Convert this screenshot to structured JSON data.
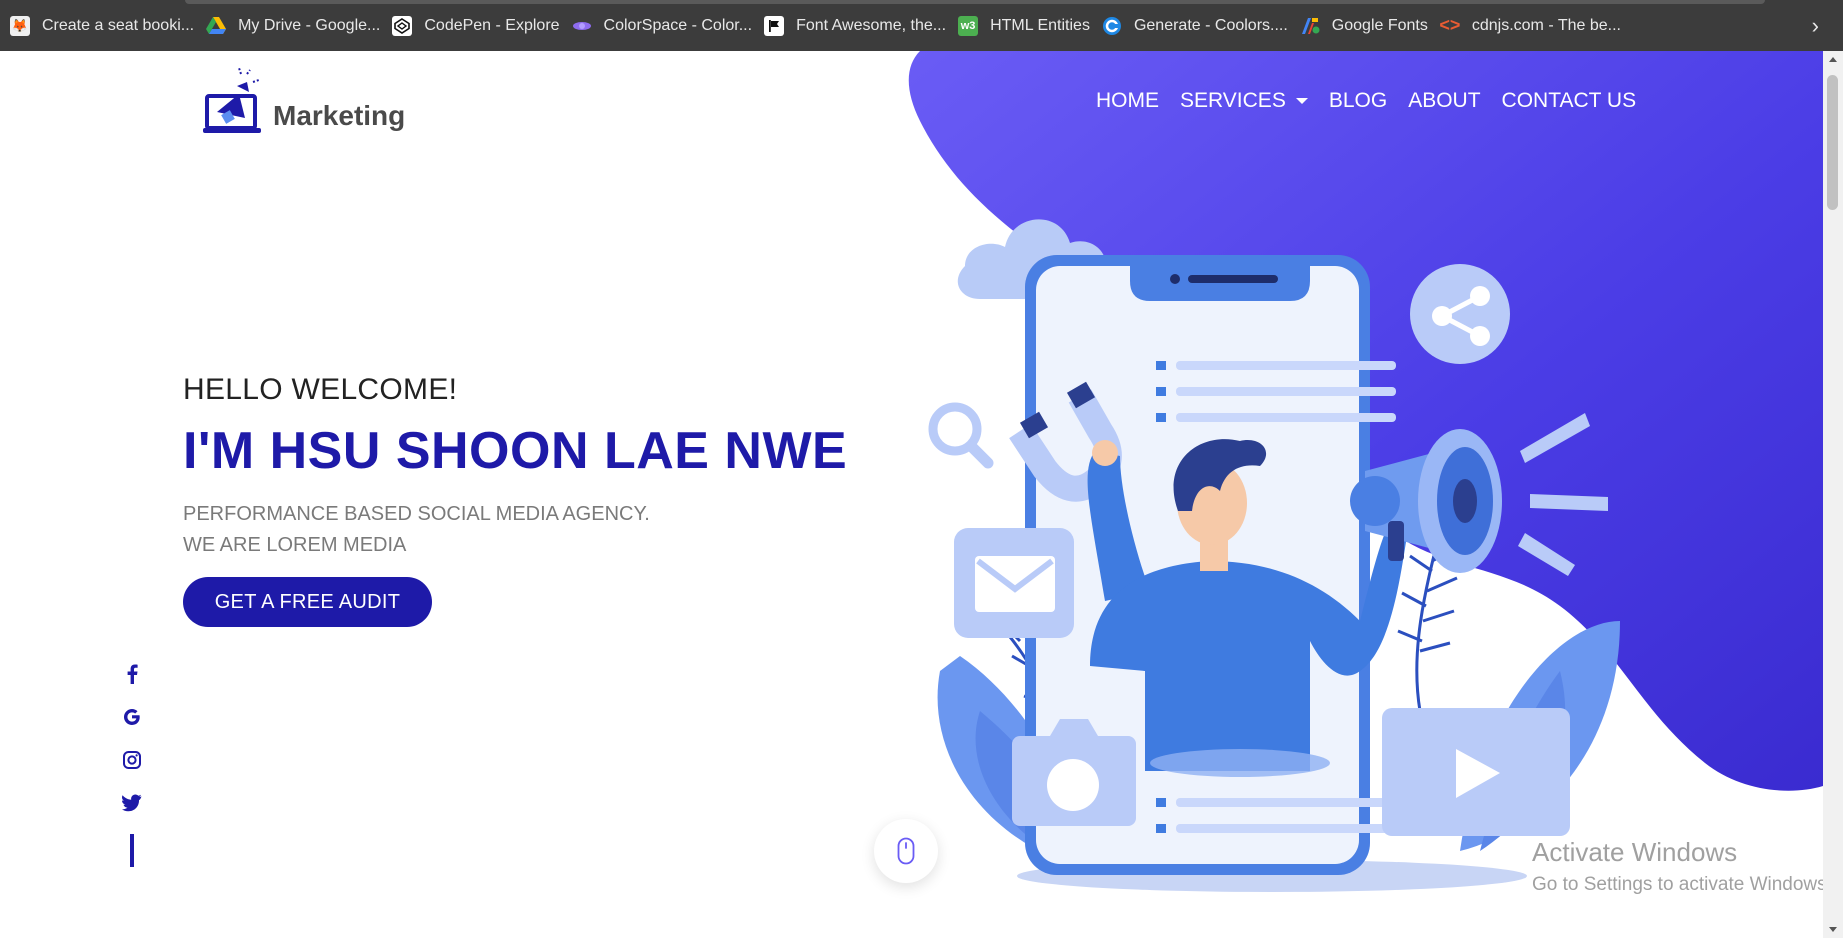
{
  "bookmarks": [
    {
      "label": "Create a seat booki...",
      "icon": "fox-icon",
      "color": "#f0f0f0"
    },
    {
      "label": "My Drive - Google...",
      "icon": "google-drive-icon",
      "color": "#34a853"
    },
    {
      "label": "CodePen - Explore",
      "icon": "codepen-icon",
      "color": "#ffffff"
    },
    {
      "label": "ColorSpace - Color...",
      "icon": "colorspace-icon",
      "color": "#8e6cf0"
    },
    {
      "label": "Font Awesome, the...",
      "icon": "flag-icon",
      "color": "#ffffff"
    },
    {
      "label": "HTML Entities",
      "icon": "w3-icon",
      "color": "#4caf50"
    },
    {
      "label": "Generate - Coolors....",
      "icon": "coolors-icon",
      "color": "#1e88e5"
    },
    {
      "label": "Google Fonts",
      "icon": "google-fonts-icon",
      "color": "#fbbc04"
    },
    {
      "label": "cdnjs.com - The be...",
      "icon": "code-brackets-icon",
      "color": "#e85c33"
    }
  ],
  "logo": {
    "text": "Marketing"
  },
  "nav": {
    "home": "HOME",
    "services": "SERVICES",
    "blog": "BLOG",
    "about": "ABOUT",
    "contact": "CONTACT US"
  },
  "hero": {
    "welcome": "HELLO WELCOME!",
    "name": "I'M HSU SHOON LAE NWE",
    "sub_line1": "PERFORMANCE BASED SOCIAL MEDIA AGENCY.",
    "sub_line2": "WE ARE LOREM MEDIA",
    "cta": "GET A FREE AUDIT"
  },
  "social": [
    "facebook-icon",
    "google-icon",
    "instagram-icon",
    "twitter-icon"
  ],
  "watermark": {
    "title": "Activate Windows",
    "subtitle": "Go to Settings to activate Windows."
  },
  "colors": {
    "brand": "#1e1aa8",
    "blob_start": "#5b4df0",
    "blob_end": "#3a2bd0",
    "illustration_blue": "#3f7be0"
  }
}
